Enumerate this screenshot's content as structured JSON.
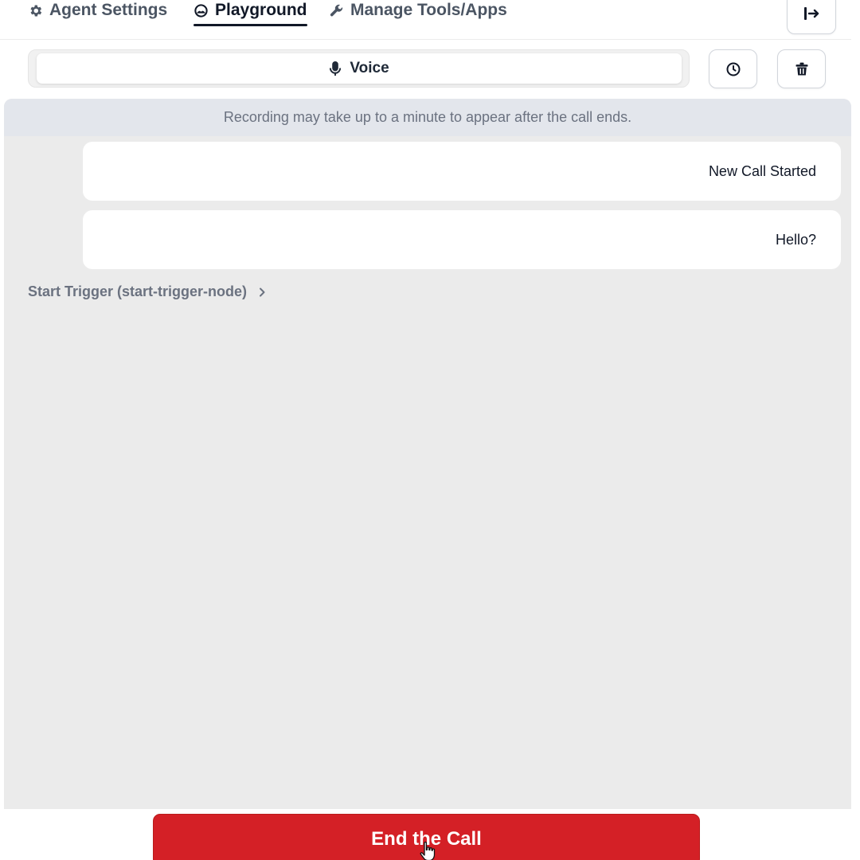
{
  "tabs": [
    {
      "label": "Agent Settings",
      "icon": "gear-icon",
      "active": false
    },
    {
      "label": "Playground",
      "icon": "gauge-icon",
      "active": true
    },
    {
      "label": "Manage Tools/Apps",
      "icon": "wrench-icon",
      "active": false
    }
  ],
  "toolbar": {
    "exit_icon": "exit-icon",
    "mode_label": "Voice",
    "mode_icon": "microphone-icon",
    "history_icon": "clock-icon",
    "delete_icon": "trash-icon"
  },
  "notice": "Recording may take up to a minute to appear after the call ends.",
  "messages": [
    {
      "text": "New Call Started"
    },
    {
      "text": "Hello?"
    }
  ],
  "trigger": {
    "label": "Start Trigger (start-trigger-node)",
    "icon": "chevron-right-icon"
  },
  "end_button": {
    "label": "End the Call"
  },
  "colors": {
    "accent": "#d42026",
    "notice_bg": "#e3e6ec",
    "canvas_bg": "#ebebeb"
  }
}
